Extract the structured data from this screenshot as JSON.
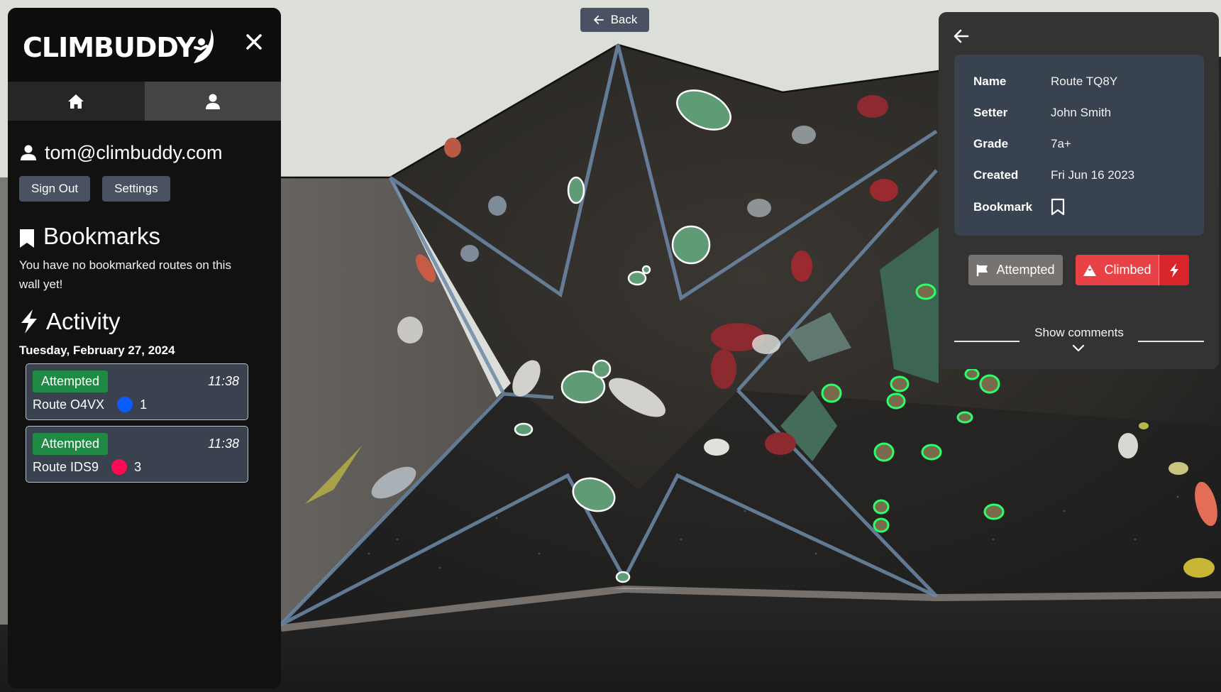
{
  "app": {
    "brand": "CLIMBUDDY",
    "back_button": {
      "label": "Back",
      "icon": "arrow-left-icon"
    }
  },
  "sidebar": {
    "close_icon": "close-icon",
    "tabs": [
      {
        "name": "home",
        "icon": "home-icon",
        "active": false
      },
      {
        "name": "profile",
        "icon": "user-icon",
        "active": true
      }
    ],
    "user": {
      "email": "tom@climbuddy.com",
      "icon": "user-icon"
    },
    "buttons": {
      "sign_out": "Sign Out",
      "settings": "Settings"
    },
    "bookmarks": {
      "title": "Bookmarks",
      "icon": "bookmark-icon",
      "empty_message": "You have no bookmarked routes on this wall yet!"
    },
    "activity": {
      "title": "Activity",
      "icon": "lightning-icon",
      "groups": [
        {
          "date": "Tuesday, February 27, 2024",
          "items": [
            {
              "status": "Attempted",
              "time": "11:38",
              "route": "Route O4VX",
              "color": "#0a5cff",
              "count": "1"
            },
            {
              "status": "Attempted",
              "time": "11:38",
              "route": "Route IDS9",
              "color": "#ff0a55",
              "count": "3"
            }
          ]
        }
      ]
    }
  },
  "route_panel": {
    "back_icon": "arrow-left-icon",
    "details": [
      {
        "label": "Name",
        "value": "Route TQ8Y"
      },
      {
        "label": "Setter",
        "value": "John Smith"
      },
      {
        "label": "Grade",
        "value": "7a+"
      },
      {
        "label": "Created",
        "value": "Fri Jun 16 2023"
      },
      {
        "label": "Bookmark",
        "value": "",
        "icon": "bookmark-outline-icon"
      }
    ],
    "actions": {
      "attempted": "Attempted",
      "climbed": "Climbed",
      "flash_icon": "lightning-icon"
    },
    "comments_toggle": "Show comments"
  },
  "colors": {
    "attempted_badge": "#1e8a44",
    "climbed": "#e94246",
    "flash": "#d9262b",
    "selected_hold_outline": "#ffffff",
    "highlighted_hold_outline": "#2aff6a"
  }
}
